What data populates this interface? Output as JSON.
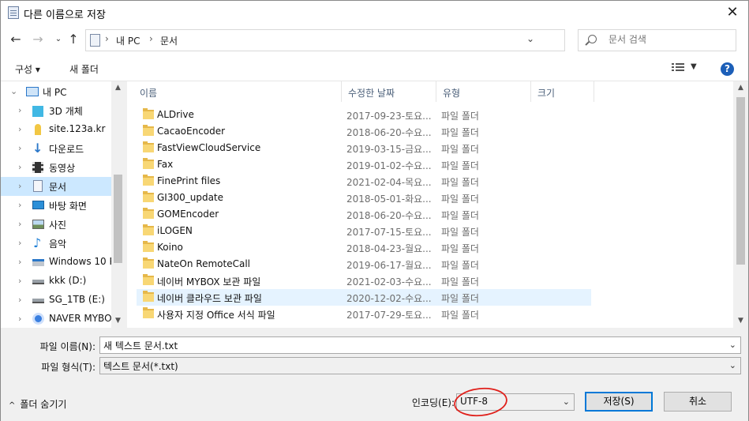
{
  "window": {
    "title": "다른 이름으로 저장",
    "close": "✕"
  },
  "address": {
    "parts": [
      "내 PC",
      "문서"
    ],
    "search_placeholder": "문서 검색"
  },
  "toolbar": {
    "organize": "구성 ▾",
    "new_folder": "새 폴더",
    "help": "?"
  },
  "nav": [
    {
      "label": "내 PC",
      "icon": "pc-icon",
      "expanded": true,
      "indent": 0
    },
    {
      "label": "3D 개체",
      "icon": "cube-icon",
      "indent": 1
    },
    {
      "label": "site.123a.kr",
      "icon": "person-icon",
      "indent": 1
    },
    {
      "label": "다운로드",
      "icon": "download-icon",
      "indent": 1
    },
    {
      "label": "동영상",
      "icon": "film-icon",
      "indent": 1
    },
    {
      "label": "문서",
      "icon": "document-icon",
      "indent": 1,
      "selected": true
    },
    {
      "label": "바탕 화면",
      "icon": "desktop-icon",
      "indent": 1
    },
    {
      "label": "사진",
      "icon": "picture-icon",
      "indent": 1
    },
    {
      "label": "음악",
      "icon": "music-icon",
      "indent": 1
    },
    {
      "label": "Windows 10 P",
      "icon": "windows-drive-icon",
      "indent": 1
    },
    {
      "label": "kkk (D:)",
      "icon": "drive-icon",
      "indent": 1
    },
    {
      "label": "SG_1TB (E:)",
      "icon": "drive-icon",
      "indent": 1
    },
    {
      "label": "NAVER MYBO>",
      "icon": "naver-icon",
      "indent": 1
    }
  ],
  "columns": {
    "name": "이름",
    "date": "수정한 날짜",
    "type": "유형",
    "size": "크기"
  },
  "files": [
    {
      "name": "ALDrive",
      "date": "2017-09-23-토요...",
      "type": "파일 폴더"
    },
    {
      "name": "CacaoEncoder",
      "date": "2018-06-20-수요...",
      "type": "파일 폴더"
    },
    {
      "name": "FastViewCloudService",
      "date": "2019-03-15-금요...",
      "type": "파일 폴더"
    },
    {
      "name": "Fax",
      "date": "2019-01-02-수요...",
      "type": "파일 폴더"
    },
    {
      "name": "FinePrint files",
      "date": "2021-02-04-목요...",
      "type": "파일 폴더"
    },
    {
      "name": "GI300_update",
      "date": "2018-05-01-화요...",
      "type": "파일 폴더"
    },
    {
      "name": "GOMEncoder",
      "date": "2018-06-20-수요...",
      "type": "파일 폴더"
    },
    {
      "name": "iLOGEN",
      "date": "2017-07-15-토요...",
      "type": "파일 폴더"
    },
    {
      "name": "Koino",
      "date": "2018-04-23-월요...",
      "type": "파일 폴더"
    },
    {
      "name": "NateOn RemoteCall",
      "date": "2019-06-17-월요...",
      "type": "파일 폴더"
    },
    {
      "name": "네이버 MYBOX 보관 파일",
      "date": "2021-02-03-수요...",
      "type": "파일 폴더"
    },
    {
      "name": "네이버 클라우드 보관 파일",
      "date": "2020-12-02-수요...",
      "type": "파일 폴더",
      "hover": true
    },
    {
      "name": "사용자 지정 Office 서식 파일",
      "date": "2017-07-29-토요...",
      "type": "파일 폴더"
    }
  ],
  "bottom": {
    "filename_label": "파일 이름(N):",
    "filename_value": "새 텍스트 문서.txt",
    "filetype_label": "파일 형식(T):",
    "filetype_value": "텍스트 문서(*.txt)",
    "hide_folders": "폴더 숨기기",
    "encoding_label": "인코딩(E):",
    "encoding_value": "UTF-8",
    "save": "저장(S)",
    "cancel": "취소"
  },
  "colors": {
    "selected": "#cce8ff",
    "hover": "#e5f3ff",
    "annotation": "#e0201b"
  }
}
